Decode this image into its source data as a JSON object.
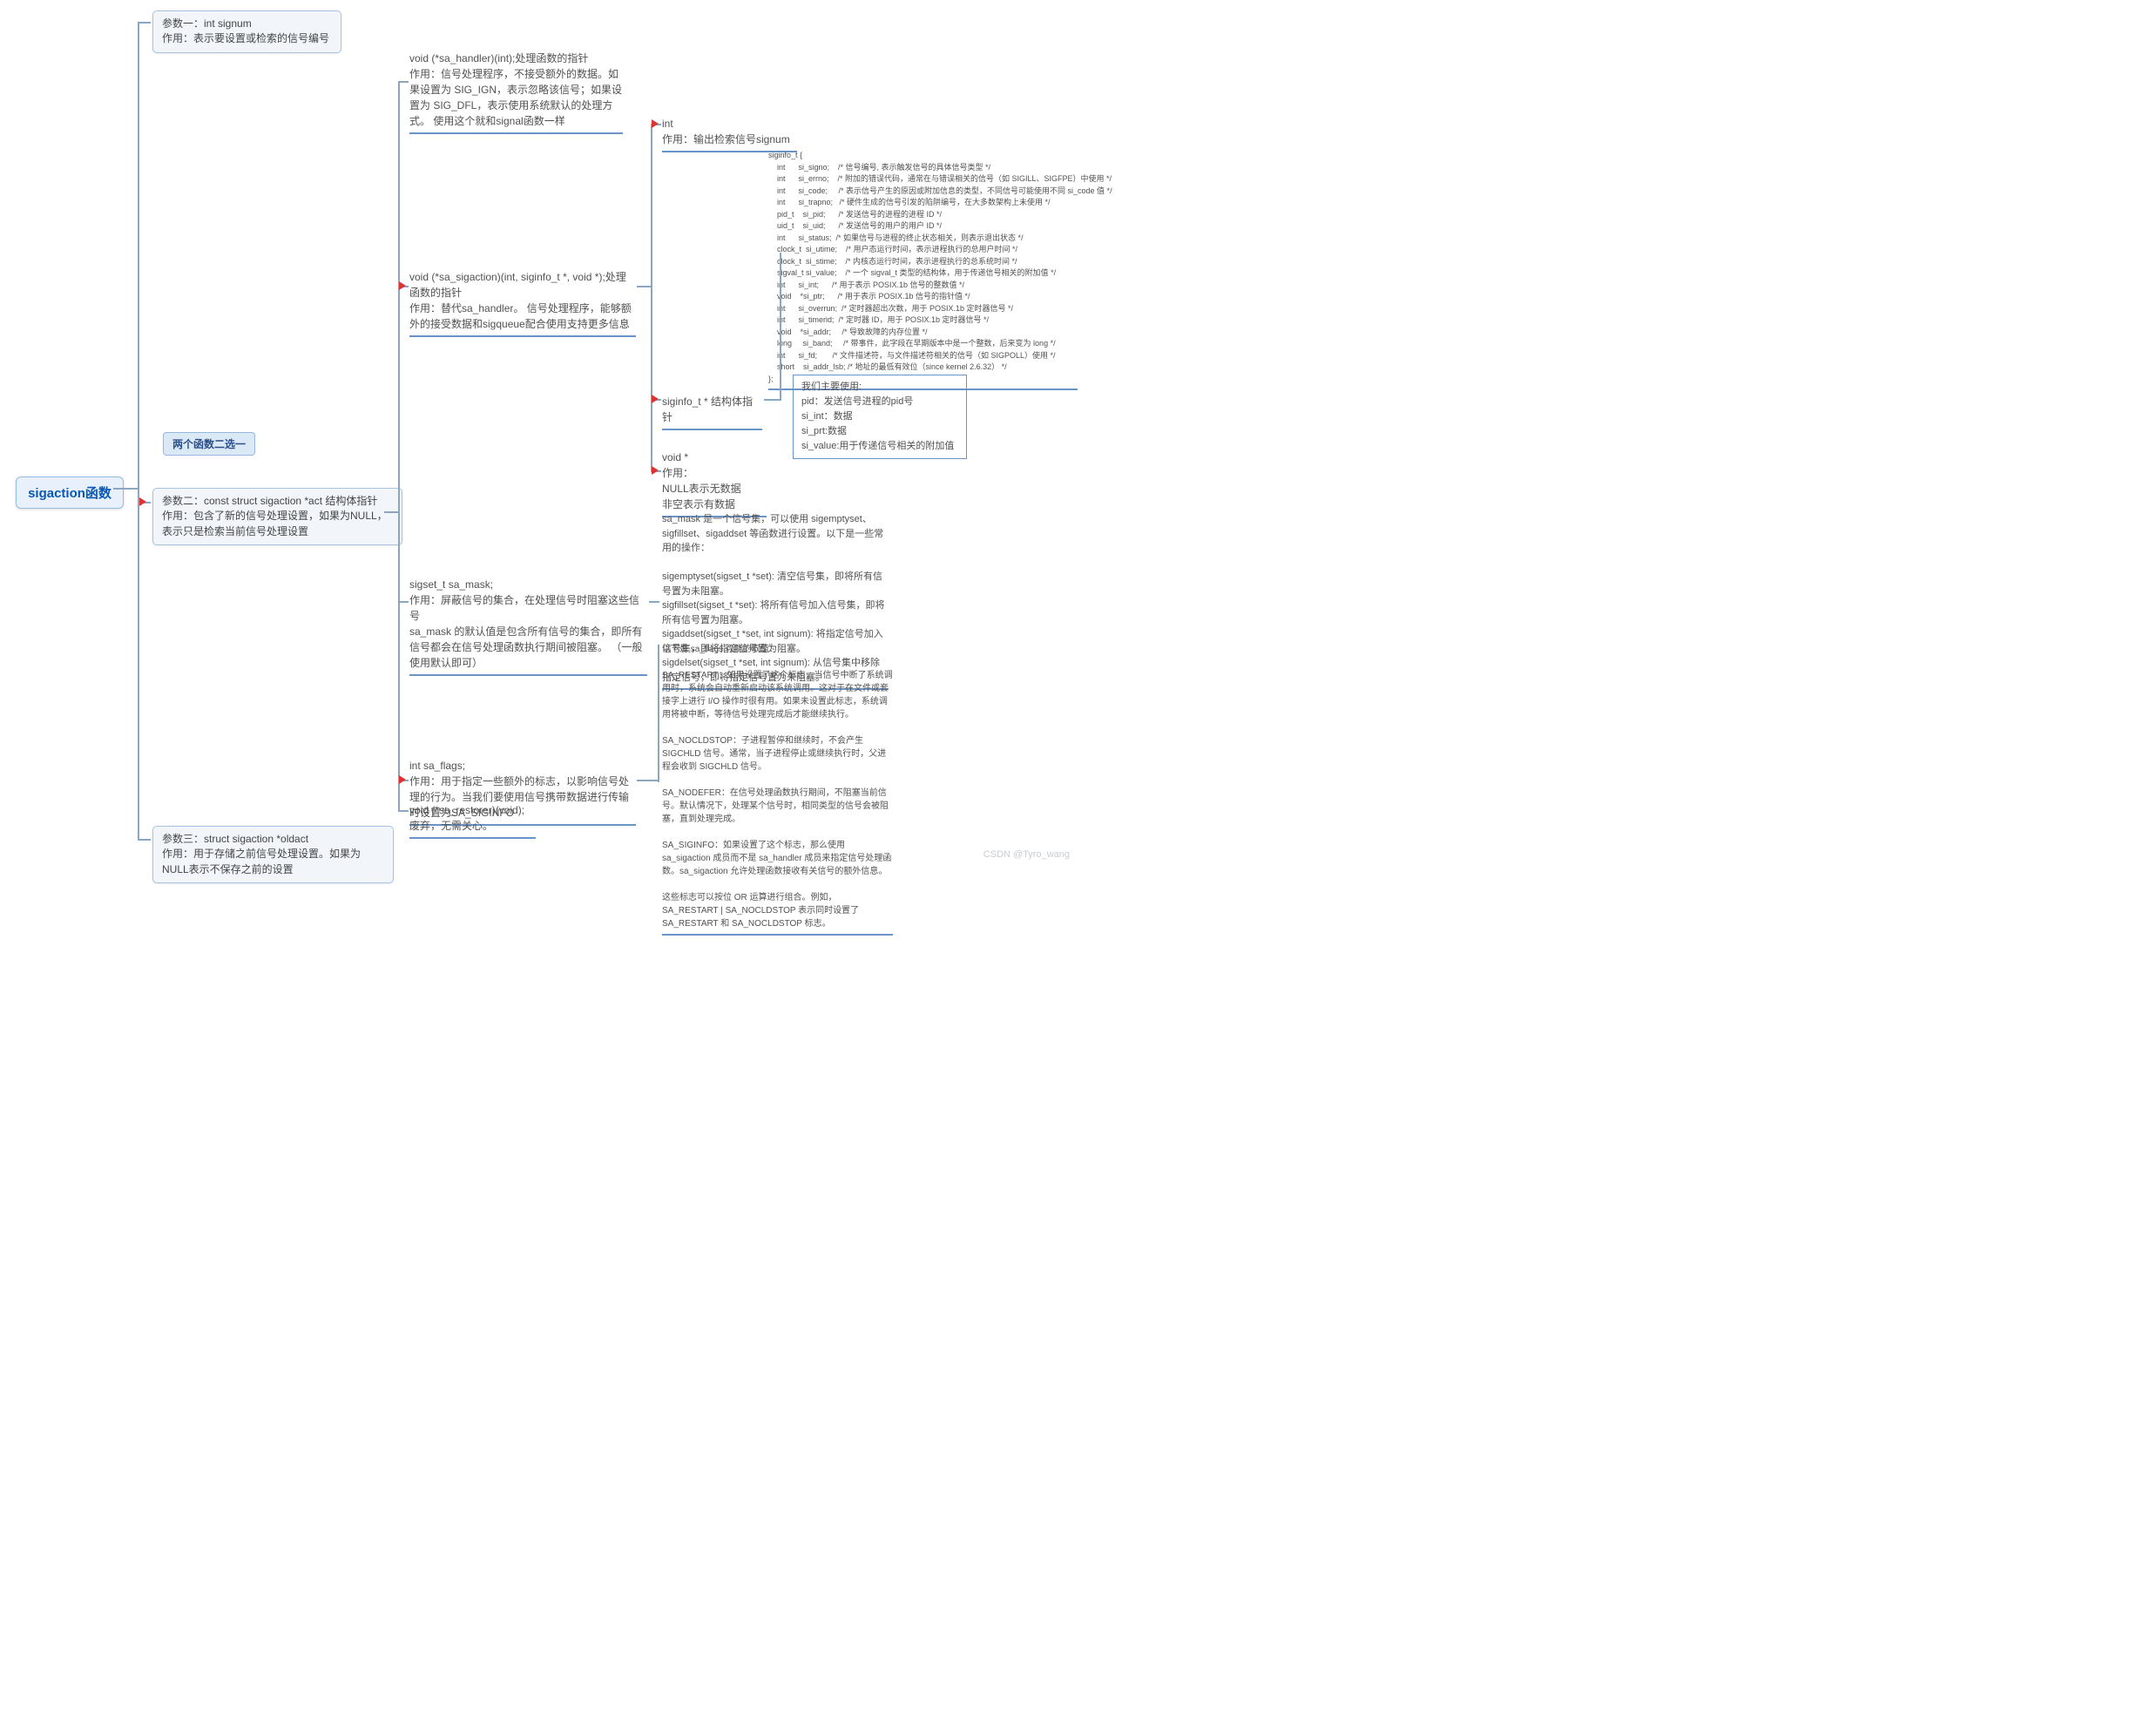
{
  "root": "sigaction函数",
  "param1": {
    "title": "参数一：int signum",
    "desc": "作用：表示要设置或检索的信号编号"
  },
  "choice_tag": "两个函数二选一",
  "param2": {
    "title": "参数二：const struct sigaction *act  结构体指针",
    "desc": "作用：包含了新的信号处理设置，如果为NULL，表示只是检索当前信号处理设置"
  },
  "param3": {
    "title": "参数三：struct sigaction *oldact",
    "desc": "作用：用于存储之前信号处理设置。如果为NULL表示不保存之前的设置"
  },
  "sa_handler": "void (*sa_handler)(int);处理函数的指针\n作用：信号处理程序，不接受额外的数据。如果设置为 SIG_IGN，表示忽略该信号；如果设置为 SIG_DFL，表示使用系统默认的处理方式。 使用这个就和signal函数一样",
  "sa_sigaction": "void (*sa_sigaction)(int, siginfo_t *, void *);处理函数的指针\n作用：替代sa_handler。 信号处理程序，能够额外的接受数据和sigqueue配合使用支持更多信息",
  "arg_int": "int\n作用：输出检索信号signum",
  "siginfo_struct": "siginfo_t {\n    int      si_signo;    /* 信号编号, 表示触发信号的具体信号类型 */\n    int      si_errno;    /* 附加的错误代码，通常在与错误相关的信号（如 SIGILL、SIGFPE）中使用 */\n    int      si_code;     /* 表示信号产生的原因或附加信息的类型，不同信号可能使用不同 si_code 值 */\n    int      si_trapno;   /* 硬件生成的信号引发的陷阱编号，在大多数架构上未使用 */\n    pid_t    si_pid;      /* 发送信号的进程的进程 ID */\n    uid_t    si_uid;      /* 发送信号的用户的用户 ID */\n    int      si_status;  /* 如果信号与进程的终止状态相关，则表示退出状态 */\n    clock_t  si_utime;    /* 用户态运行时间，表示进程执行的总用户时间 */\n    clock_t  si_stime;    /* 内核态运行时间，表示进程执行的总系统时间 */\n    sigval_t si_value;    /* 一个 sigval_t 类型的结构体，用于传递信号相关的附加值 */\n    int      si_int;      /* 用于表示 POSIX.1b 信号的整数值 */\n    void    *si_ptr;      /* 用于表示 POSIX.1b 信号的指针值 */\n    int      si_overrun;  /* 定时器超出次数，用于 POSIX.1b 定时器信号 */\n    int      si_timerid;  /* 定时器 ID，用于 POSIX.1b 定时器信号 */\n    void    *si_addr;     /* 导致故障的内存位置 */\n    long     si_band;     /* 带事件，此字段在早期版本中是一个整数，后来变为 long */\n    int      si_fd;       /* 文件描述符，与文件描述符相关的信号（如 SIGPOLL）使用 */\n    short    si_addr_lsb; /* 地址的最低有效位（since kernel 2.6.32） */\n};",
  "siginfo_ptr": "siginfo_t * 结构体指针",
  "siginfo_use": "我们主要使用:\npid：发送信号进程的pid号\nsi_int：数据\nsi_prt:数据\nsi_value:用于传递信号相关的附加值",
  "voidptr": "void *\n作用：\nNULL表示无数据\n非空表示有数据",
  "sa_mask": "sigset_t sa_mask;\n作用：屏蔽信号的集合，在处理信号时阻塞这些信号\nsa_mask 的默认值是包含所有信号的集合，即所有信号都会在信号处理函数执行期间被阻塞。 （一般使用默认即可）",
  "sa_mask_ops": "sa_mask 是一个信号集，可以使用 sigemptyset、sigfillset、sigaddset 等函数进行设置。以下是一些常用的操作：\n\nsigemptyset(sigset_t *set): 清空信号集，即将所有信号置为未阻塞。\nsigfillset(sigset_t *set): 将所有信号加入信号集，即将所有信号置为阻塞。\nsigaddset(sigset_t *set, int signum): 将指定信号加入信号集，即将指定信号置为阻塞。\nsigdelset(sigset_t *set, int signum): 从信号集中移除指定信号，即将指定信号置为未阻塞。",
  "sa_flags": "int sa_flags;\n作用：用于指定一些额外的标志，以影响信号处理的行为。当我们要使用信号携带数据进行传输时设置为SA_SIGINFO",
  "sa_flags_vals": "以下是 sa_flags 可能的取值：\n\nSA_RESTART：如果设置了这个标志，当信号中断了系统调用时，系统会自动重新启动该系统调用。这对于在文件或套接字上进行 I/O 操作时很有用。如果未设置此标志，系统调用将被中断，等待信号处理完成后才能继续执行。\n\nSA_NOCLDSTOP：子进程暂停和继续时，不会产生 SIGCHLD 信号。通常，当子进程停止或继续执行时，父进程会收到 SIGCHLD 信号。\n\nSA_NODEFER：在信号处理函数执行期间，不阻塞当前信号。默认情况下，处理某个信号时，相同类型的信号会被阻塞，直到处理完成。\n\nSA_SIGINFO：如果设置了这个标志，那么使用 sa_sigaction 成员而不是 sa_handler 成员来指定信号处理函数。sa_sigaction 允许处理函数接收有关信号的额外信息。\n\n这些标志可以按位 OR 运算进行组合。例如，SA_RESTART | SA_NOCLDSTOP 表示同时设置了 SA_RESTART 和 SA_NOCLDSTOP 标志。",
  "sa_restorer": "void (*sa_restorer)(void);\n废弃，无需关心。",
  "watermark": "CSDN @Tyro_wang"
}
